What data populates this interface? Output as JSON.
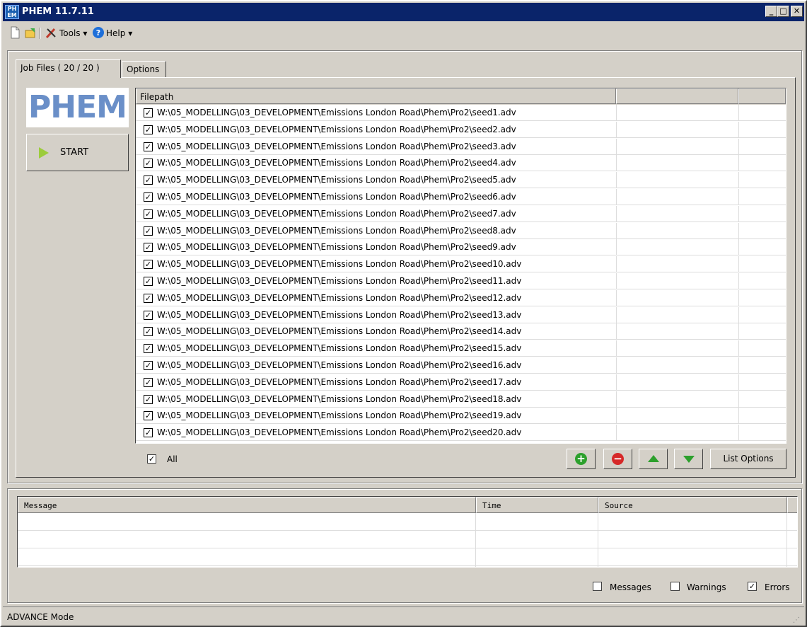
{
  "window": {
    "title": "PHEM 11.7.11",
    "app_icon_text": "PH EM",
    "min_glyph": "_",
    "max_glyph": "□",
    "close_glyph": "✕"
  },
  "toolbar": {
    "new_icon": "new-document-icon",
    "open_icon": "open-file-icon",
    "tools_label": "Tools",
    "help_label": "Help",
    "dropdown_glyph": "▾"
  },
  "tabs": [
    {
      "label": "Job Files ( 20 / 20 )",
      "active": true
    },
    {
      "label": "Options",
      "active": false
    }
  ],
  "logo_text": "PHEM",
  "start_button": {
    "label": "START"
  },
  "file_list": {
    "header": "Filepath",
    "rows": [
      {
        "checked": true,
        "path": "W:\\05_MODELLING\\03_DEVELOPMENT\\Emissions London Road\\Phem\\Pro2\\seed1.adv"
      },
      {
        "checked": true,
        "path": "W:\\05_MODELLING\\03_DEVELOPMENT\\Emissions London Road\\Phem\\Pro2\\seed2.adv"
      },
      {
        "checked": true,
        "path": "W:\\05_MODELLING\\03_DEVELOPMENT\\Emissions London Road\\Phem\\Pro2\\seed3.adv"
      },
      {
        "checked": true,
        "path": "W:\\05_MODELLING\\03_DEVELOPMENT\\Emissions London Road\\Phem\\Pro2\\seed4.adv"
      },
      {
        "checked": true,
        "path": "W:\\05_MODELLING\\03_DEVELOPMENT\\Emissions London Road\\Phem\\Pro2\\seed5.adv"
      },
      {
        "checked": true,
        "path": "W:\\05_MODELLING\\03_DEVELOPMENT\\Emissions London Road\\Phem\\Pro2\\seed6.adv"
      },
      {
        "checked": true,
        "path": "W:\\05_MODELLING\\03_DEVELOPMENT\\Emissions London Road\\Phem\\Pro2\\seed7.adv"
      },
      {
        "checked": true,
        "path": "W:\\05_MODELLING\\03_DEVELOPMENT\\Emissions London Road\\Phem\\Pro2\\seed8.adv"
      },
      {
        "checked": true,
        "path": "W:\\05_MODELLING\\03_DEVELOPMENT\\Emissions London Road\\Phem\\Pro2\\seed9.adv"
      },
      {
        "checked": true,
        "path": "W:\\05_MODELLING\\03_DEVELOPMENT\\Emissions London Road\\Phem\\Pro2\\seed10.adv"
      },
      {
        "checked": true,
        "path": "W:\\05_MODELLING\\03_DEVELOPMENT\\Emissions London Road\\Phem\\Pro2\\seed11.adv"
      },
      {
        "checked": true,
        "path": "W:\\05_MODELLING\\03_DEVELOPMENT\\Emissions London Road\\Phem\\Pro2\\seed12.adv"
      },
      {
        "checked": true,
        "path": "W:\\05_MODELLING\\03_DEVELOPMENT\\Emissions London Road\\Phem\\Pro2\\seed13.adv"
      },
      {
        "checked": true,
        "path": "W:\\05_MODELLING\\03_DEVELOPMENT\\Emissions London Road\\Phem\\Pro2\\seed14.adv"
      },
      {
        "checked": true,
        "path": "W:\\05_MODELLING\\03_DEVELOPMENT\\Emissions London Road\\Phem\\Pro2\\seed15.adv"
      },
      {
        "checked": true,
        "path": "W:\\05_MODELLING\\03_DEVELOPMENT\\Emissions London Road\\Phem\\Pro2\\seed16.adv"
      },
      {
        "checked": true,
        "path": "W:\\05_MODELLING\\03_DEVELOPMENT\\Emissions London Road\\Phem\\Pro2\\seed17.adv"
      },
      {
        "checked": true,
        "path": "W:\\05_MODELLING\\03_DEVELOPMENT\\Emissions London Road\\Phem\\Pro2\\seed18.adv"
      },
      {
        "checked": true,
        "path": "W:\\05_MODELLING\\03_DEVELOPMENT\\Emissions London Road\\Phem\\Pro2\\seed19.adv"
      },
      {
        "checked": true,
        "path": "W:\\05_MODELLING\\03_DEVELOPMENT\\Emissions London Road\\Phem\\Pro2\\seed20.adv"
      }
    ]
  },
  "all_checkbox": {
    "label": "All",
    "checked": true
  },
  "list_buttons": {
    "add_glyph": "+",
    "remove_glyph": "−",
    "list_options_label": "List Options"
  },
  "message_log": {
    "columns": [
      "Message",
      "Time",
      "Source"
    ],
    "rows": []
  },
  "filters": [
    {
      "label": "Messages",
      "checked": false
    },
    {
      "label": "Warnings",
      "checked": false
    },
    {
      "label": "Errors",
      "checked": true
    }
  ],
  "status_bar": {
    "text": "ADVANCE Mode"
  },
  "check_glyph": "✓",
  "colors": {
    "title_bar": "#0a246a",
    "face": "#d4d0c8",
    "logo": "#6a8fc8",
    "start_arrow": "#9ccc3c",
    "add_green": "#2ca02c",
    "remove_red": "#d62828"
  }
}
